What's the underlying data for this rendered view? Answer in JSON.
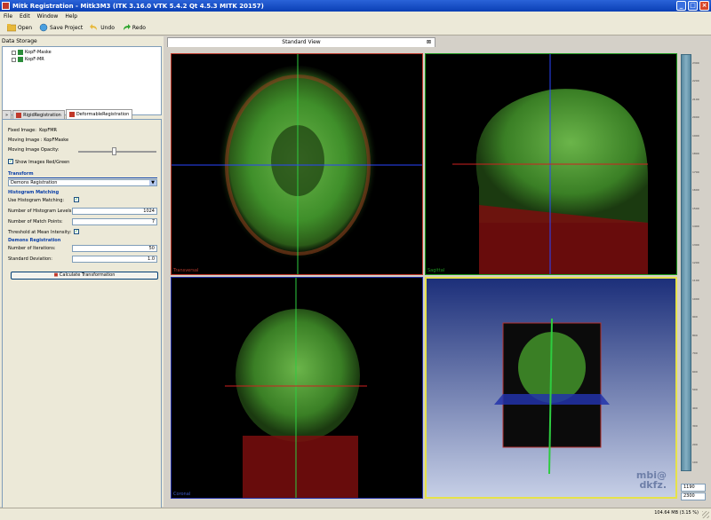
{
  "window": {
    "title": "Mitk Registration - Mitk3M3 (ITK 3.16.0  VTK 5.4.2 Qt 4.5.3 MITK 20157)"
  },
  "menu": [
    "File",
    "Edit",
    "Window",
    "Help"
  ],
  "toolbar": {
    "open": "Open",
    "save": "Save Project",
    "undo": "Undo",
    "redo": "Redo"
  },
  "data_storage": {
    "title": "Data Storage",
    "items": [
      {
        "label": "KopF-Maske"
      },
      {
        "label": "KopF-MR"
      }
    ]
  },
  "tabs": [
    {
      "label": "RigidRegistration",
      "active": false
    },
    {
      "label": "DeformableRegistration",
      "active": true
    }
  ],
  "registration": {
    "fixed_label": "Fixed Image:",
    "fixed_value": "KopFMR",
    "moving_label": "Moving Image :",
    "moving_value": "KopFMaske",
    "opacity_label": "Moving Image Opacity:",
    "opacity_value": 0.45,
    "show_rg_label": "Show Images Red/Green",
    "show_rg_checked": true,
    "transform_title": "Transform",
    "transform_selected": "Demons Registration",
    "hist_title": "Histogram Matching",
    "use_hist_label": "Use Histogram Matching:",
    "use_hist_checked": true,
    "levels_label": "Number of Histogram Levels:",
    "levels_value": "1024",
    "match_label": "Number of Match Points:",
    "match_value": "7",
    "threshold_label": "Threshold at Mean Intensity:",
    "threshold_checked": true,
    "demons_title": "Demons Registration",
    "iter_label": "Number of Iterations:",
    "iter_value": "50",
    "stddev_label": "Standard Deviation:",
    "stddev_value": "1.0",
    "calc_label": "Calculate Transformation"
  },
  "view": {
    "tab_label": "Standard View",
    "labels": {
      "transversal": "Transversal",
      "sagittal": "Sagittal",
      "coronal": "Coronal"
    },
    "logo_line1": "mbi@",
    "logo_line2": "dkfz."
  },
  "ruler": {
    "ticks": [
      "2300",
      "2200",
      "2100",
      "2000",
      "1900",
      "1800",
      "1700",
      "1600",
      "1500",
      "1400",
      "1300",
      "1200",
      "1100",
      "1000",
      "900",
      "800",
      "700",
      "600",
      "500",
      "400",
      "300",
      "200",
      "100"
    ],
    "level": "1190",
    "window": "2300"
  },
  "status": {
    "memory": "104.64 MB (3.15 %)"
  },
  "colors": {
    "transversal": "#c0392b",
    "sagittal": "#1e9a1e",
    "coronal": "#2230a8",
    "render3d": "#e6e24a"
  }
}
